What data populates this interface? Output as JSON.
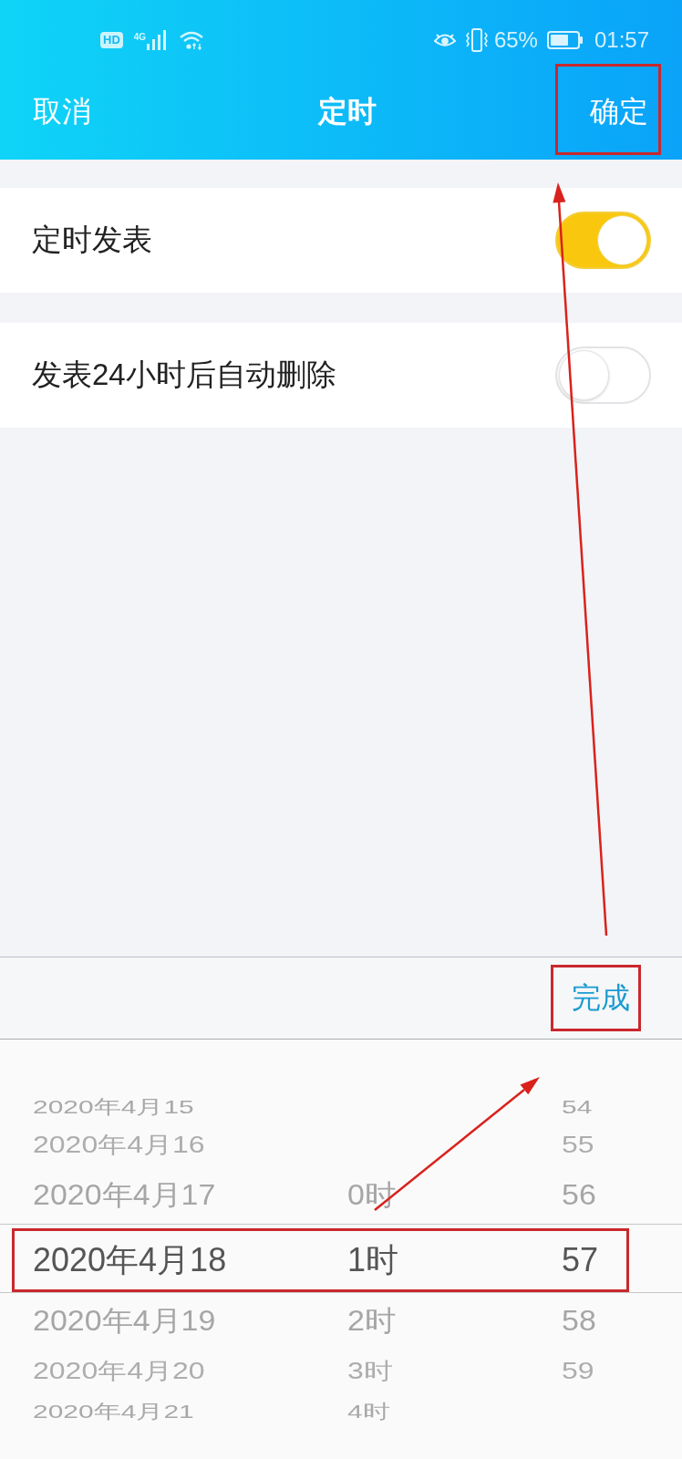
{
  "status_bar": {
    "hd_badge": "HD",
    "network": "4G",
    "battery": "65%",
    "time": "01:57"
  },
  "header": {
    "cancel": "取消",
    "title": "定时",
    "confirm": {
      "label": "确定",
      "highlighted": true
    }
  },
  "settings": [
    {
      "label": "定时发表",
      "on": true
    },
    {
      "label": "发表24小时后自动删除",
      "on": false
    }
  ],
  "picker": {
    "done": {
      "label": "完成",
      "highlighted": true
    },
    "rows": [
      {
        "date": "2020年4月15",
        "minute": "54",
        "selected": false,
        "highlighted": false
      },
      {
        "date": "2020年4月16",
        "minute": "55",
        "selected": false,
        "highlighted": false
      },
      {
        "date": "2020年4月17",
        "hour": "0时",
        "minute": "56",
        "selected": false,
        "highlighted": false
      },
      {
        "date": "2020年4月18",
        "hour": "1时",
        "minute": "57",
        "selected": true,
        "highlighted": true
      },
      {
        "date": "2020年4月19",
        "hour": "2时",
        "minute": "58",
        "selected": false,
        "highlighted": false
      },
      {
        "date": "2020年4月20",
        "hour": "3时",
        "minute": "59",
        "selected": false,
        "highlighted": false
      },
      {
        "date": "2020年4月21",
        "hour": "4时",
        "selected": false,
        "highlighted": false
      }
    ]
  }
}
